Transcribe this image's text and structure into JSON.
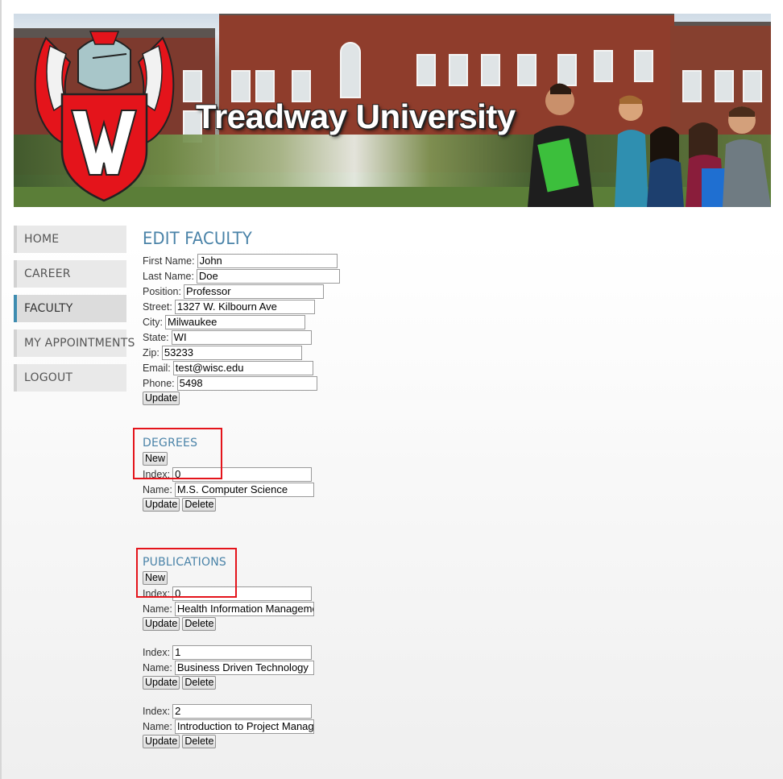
{
  "banner": {
    "title": "Treadway University"
  },
  "nav": [
    {
      "label": "HOME",
      "active": false
    },
    {
      "label": "CAREER",
      "active": false
    },
    {
      "label": "FACULTY",
      "active": true
    },
    {
      "label": "MY APPOINTMENTS",
      "active": false
    },
    {
      "label": "LOGOUT",
      "active": false
    }
  ],
  "page": {
    "title": "EDIT FACULTY"
  },
  "faculty": {
    "fields": [
      {
        "label": "First Name:",
        "value": "John"
      },
      {
        "label": "Last Name:",
        "value": "Doe"
      },
      {
        "label": "Position:",
        "value": "Professor"
      },
      {
        "label": "Street:",
        "value": "1327 W. Kilbourn Ave"
      },
      {
        "label": "City:",
        "value": "Milwaukee"
      },
      {
        "label": "State:",
        "value": "WI"
      },
      {
        "label": "Zip:",
        "value": "53233"
      },
      {
        "label": "Email:",
        "value": "test@wisc.edu"
      },
      {
        "label": "Phone:",
        "value": "5498"
      }
    ],
    "update_label": "Update"
  },
  "degrees": {
    "title": "DEGREES",
    "new_label": "New",
    "index_label": "Index:",
    "name_label": "Name:",
    "update_label": "Update",
    "delete_label": "Delete",
    "items": [
      {
        "index": "0",
        "name": "M.S. Computer Science"
      }
    ]
  },
  "publications": {
    "title": "PUBLICATIONS",
    "new_label": "New",
    "index_label": "Index:",
    "name_label": "Name:",
    "update_label": "Update",
    "delete_label": "Delete",
    "items": [
      {
        "index": "0",
        "name": "Health Information Management"
      },
      {
        "index": "1",
        "name": "Business Driven Technology"
      },
      {
        "index": "2",
        "name": "Introduction to Project Management"
      }
    ]
  },
  "colors": {
    "accent": "#4a83a8",
    "highlight": "#e4141b",
    "crest_red": "#e4141b"
  }
}
